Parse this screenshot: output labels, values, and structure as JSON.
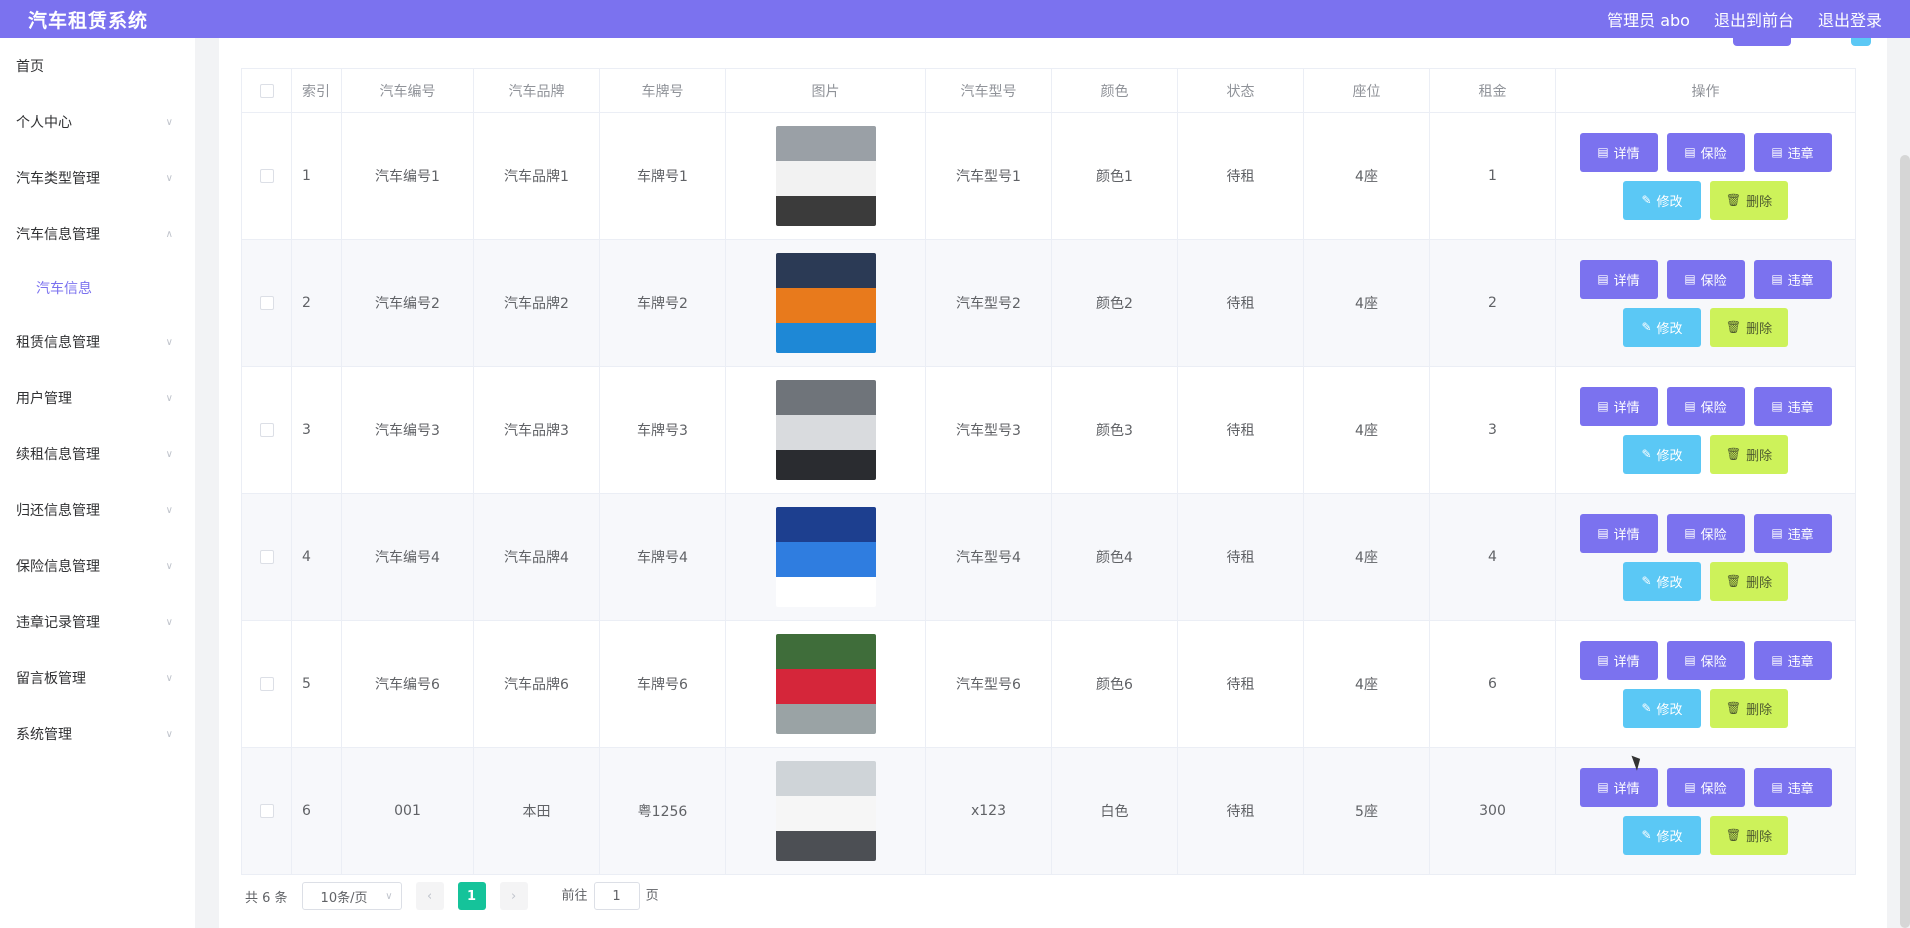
{
  "header": {
    "title": "汽车租赁系统",
    "admin": "管理员 abo",
    "to_front": "退出到前台",
    "logout": "退出登录"
  },
  "sidebar": {
    "items": [
      {
        "label": "首页"
      },
      {
        "label": "个人中心"
      },
      {
        "label": "汽车类型管理"
      },
      {
        "label": "汽车信息管理"
      },
      {
        "label": "汽车信息"
      },
      {
        "label": "租赁信息管理"
      },
      {
        "label": "用户管理"
      },
      {
        "label": "续租信息管理"
      },
      {
        "label": "归还信息管理"
      },
      {
        "label": "保险信息管理"
      },
      {
        "label": "违章记录管理"
      },
      {
        "label": "留言板管理"
      },
      {
        "label": "系统管理"
      }
    ]
  },
  "table": {
    "headers": [
      "索引",
      "汽车编号",
      "汽车品牌",
      "车牌号",
      "图片",
      "汽车型号",
      "颜色",
      "状态",
      "座位",
      "租金",
      "操作"
    ],
    "rows": [
      {
        "index": "1",
        "code": "汽车编号1",
        "brand": "汽车品牌1",
        "plate": "车牌号1",
        "model": "汽车型号1",
        "color": "颜色1",
        "status": "待租",
        "seats": "4座",
        "rent": "1"
      },
      {
        "index": "2",
        "code": "汽车编号2",
        "brand": "汽车品牌2",
        "plate": "车牌号2",
        "model": "汽车型号2",
        "color": "颜色2",
        "status": "待租",
        "seats": "4座",
        "rent": "2"
      },
      {
        "index": "3",
        "code": "汽车编号3",
        "brand": "汽车品牌3",
        "plate": "车牌号3",
        "model": "汽车型号3",
        "color": "颜色3",
        "status": "待租",
        "seats": "4座",
        "rent": "3"
      },
      {
        "index": "4",
        "code": "汽车编号4",
        "brand": "汽车品牌4",
        "plate": "车牌号4",
        "model": "汽车型号4",
        "color": "颜色4",
        "status": "待租",
        "seats": "4座",
        "rent": "4"
      },
      {
        "index": "5",
        "code": "汽车编号6",
        "brand": "汽车品牌6",
        "plate": "车牌号6",
        "model": "汽车型号6",
        "color": "颜色6",
        "status": "待租",
        "seats": "4座",
        "rent": "6"
      },
      {
        "index": "6",
        "code": "001",
        "brand": "本田",
        "plate": "粤1256",
        "model": "x123",
        "color": "白色",
        "status": "待租",
        "seats": "5座",
        "rent": "300"
      }
    ],
    "actions": {
      "detail": "详情",
      "insurance": "保险",
      "violation": "违章",
      "edit": "修改",
      "delete": "删除"
    }
  },
  "pager": {
    "total": "共 6 条",
    "page_size": "10条/页",
    "current": "1",
    "goto_prefix": "前往",
    "goto_value": "1",
    "goto_suffix": "页"
  },
  "colors": {
    "primary": "#7b72ef",
    "info": "#5bc8f5",
    "lime": "#cdf25a",
    "page_active": "#15c39a"
  }
}
